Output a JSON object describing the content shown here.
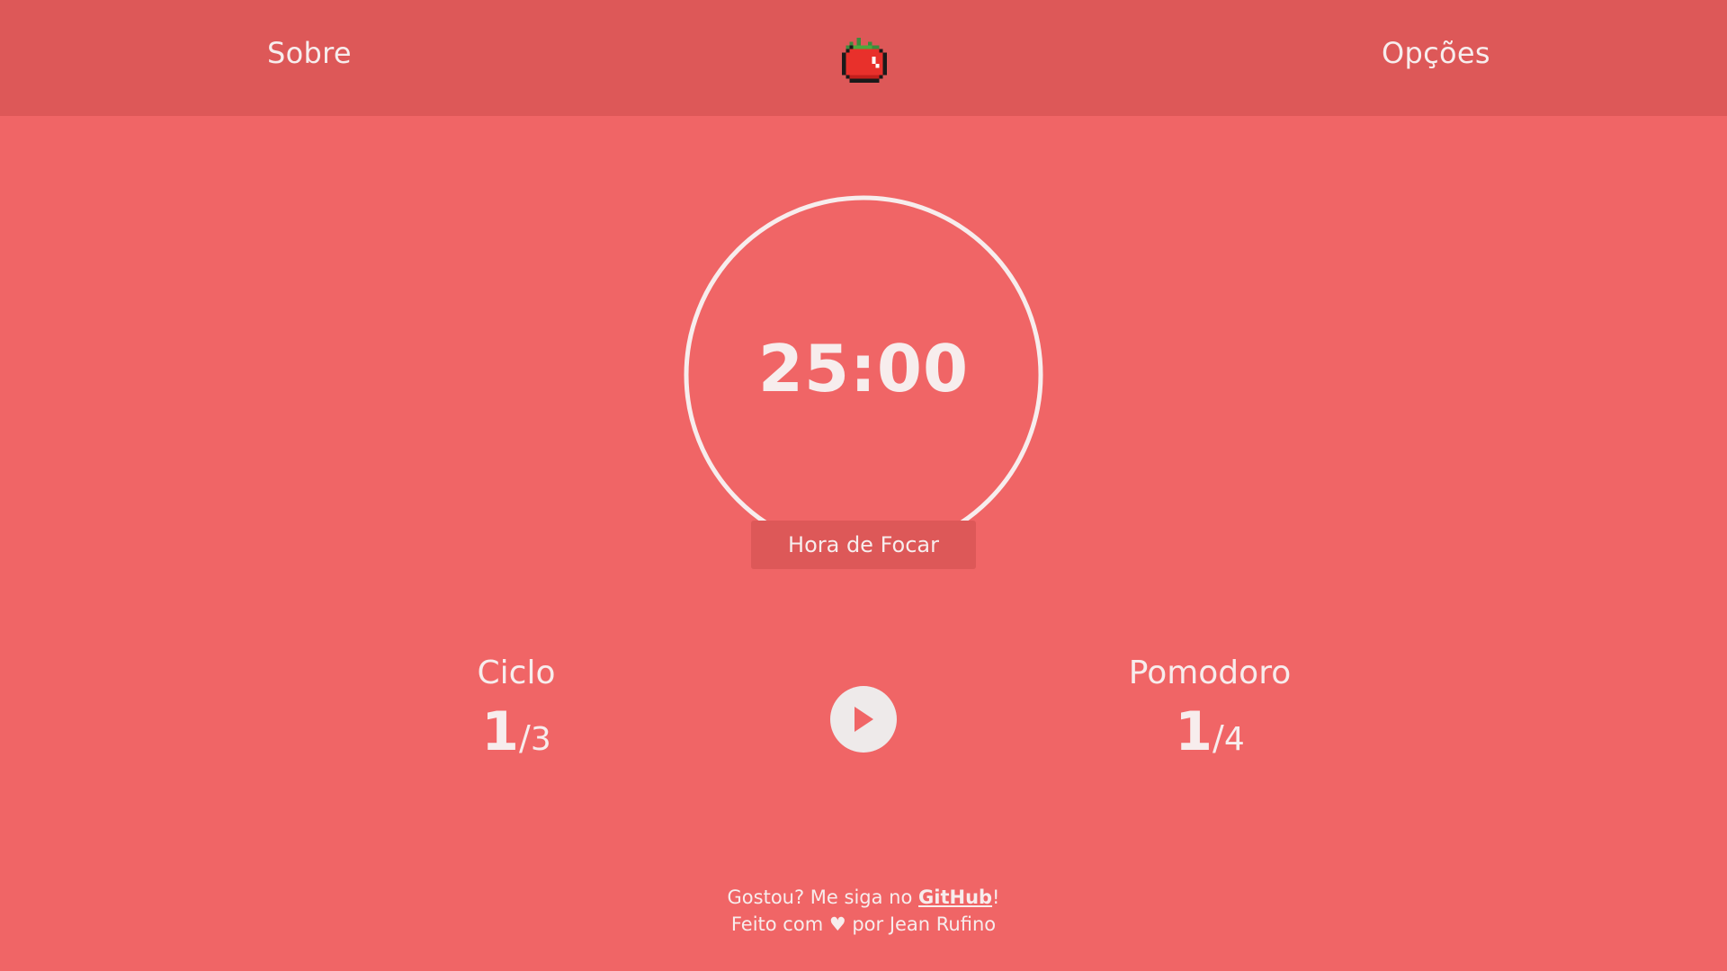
{
  "nav": {
    "about_label": "Sobre",
    "options_label": "Opções",
    "logo_icon": "tomato-icon"
  },
  "timer": {
    "time": "25:00",
    "mode_label": "Hora de Focar",
    "progress": 1.0
  },
  "stats": {
    "cycle": {
      "title": "Ciclo",
      "current": "1",
      "separator": "/",
      "total": "3"
    },
    "pomodoro": {
      "title": "Pomodoro",
      "current": "1",
      "separator": "/",
      "total": "4"
    }
  },
  "controls": {
    "play_icon": "play-icon"
  },
  "footer": {
    "line1_prefix": "Gostou? Me siga no ",
    "github_label": "GitHub",
    "line1_suffix": "!",
    "line2": "Feito com ♥ por Jean Rufino"
  },
  "colors": {
    "background": "#f06566",
    "header": "#dd5858",
    "text": "#f7eded",
    "button": "#eeeaea",
    "play_triangle": "#f06566"
  }
}
